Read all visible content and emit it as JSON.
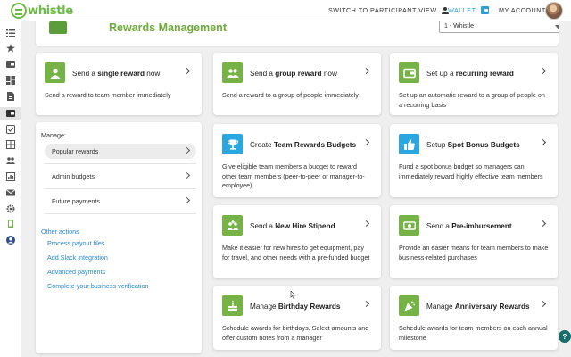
{
  "topbar": {
    "logo_text": "whistle",
    "switch_label": "SWITCH TO PARTICIPANT VIEW",
    "wallet_label": "WALLET",
    "account_label": "MY ACCOUNT"
  },
  "header": {
    "title": "Rewards Management",
    "program_select_value": "1 - Whistle"
  },
  "cards": [
    {
      "pre": "Send a ",
      "bold": "single reward",
      "post": " now",
      "desc": "Send a reward to team member immediately",
      "icon": "person-icon",
      "color": "#76b346"
    },
    {
      "pre": "Send a ",
      "bold": "group reward",
      "post": " now",
      "desc": "Send a reward to a group of people immediately",
      "icon": "group-icon",
      "color": "#76b346"
    },
    {
      "pre": "Set up a ",
      "bold": "recurring reward",
      "post": "",
      "desc": "Set up an automatic reward to a group of people on a recurring basis",
      "icon": "wallet-icon",
      "color": "#76b346"
    },
    {
      "pre": "Create ",
      "bold": "Team Rewards Budgets",
      "post": "",
      "desc": "Give eligible team members a budget to reward other team members (peer-to-peer or manager-to-employee)",
      "icon": "trophy-icon",
      "color": "#2aa6e0"
    },
    {
      "pre": "Setup ",
      "bold": "Spot Bonus Budgets",
      "post": "",
      "desc": "Fund a spot bonus budget so managers can immediately reward highly effective team members",
      "icon": "thumbs-up-icon",
      "color": "#2aa6e0"
    },
    {
      "pre": "Send a ",
      "bold": "New Hire Stipend",
      "post": "",
      "desc": "Make it easier for new hires to get equipment, pay for travel, and other needs with a pre-funded budget",
      "icon": "new-hire-icon",
      "color": "#76b346"
    },
    {
      "pre": "Send a ",
      "bold": "Pre-imbursement",
      "post": "",
      "desc": "Provide an easier means for team members to make business-related purchases",
      "icon": "money-icon",
      "color": "#76b346"
    },
    {
      "pre": "Manage ",
      "bold": "Birthday Rewards",
      "post": "",
      "desc": "Schedule awards for birthdays. Select amounts and offer custom notes from a manager",
      "icon": "cake-icon",
      "color": "#76b346"
    },
    {
      "pre": "Manage ",
      "bold": "Anniversary Rewards",
      "post": "",
      "desc": "Schedule awards for team members on each annual milestone",
      "icon": "party-icon",
      "color": "#76b346"
    }
  ],
  "manage": {
    "label": "Manage:",
    "items": [
      "Popular rewards",
      "Admin budgets",
      "Future payments"
    ],
    "other_label": "Other actions",
    "links": [
      "Process payout files",
      "Add Slack integration",
      "Advanced payments",
      "Complete your business verification"
    ]
  },
  "help": "?"
}
